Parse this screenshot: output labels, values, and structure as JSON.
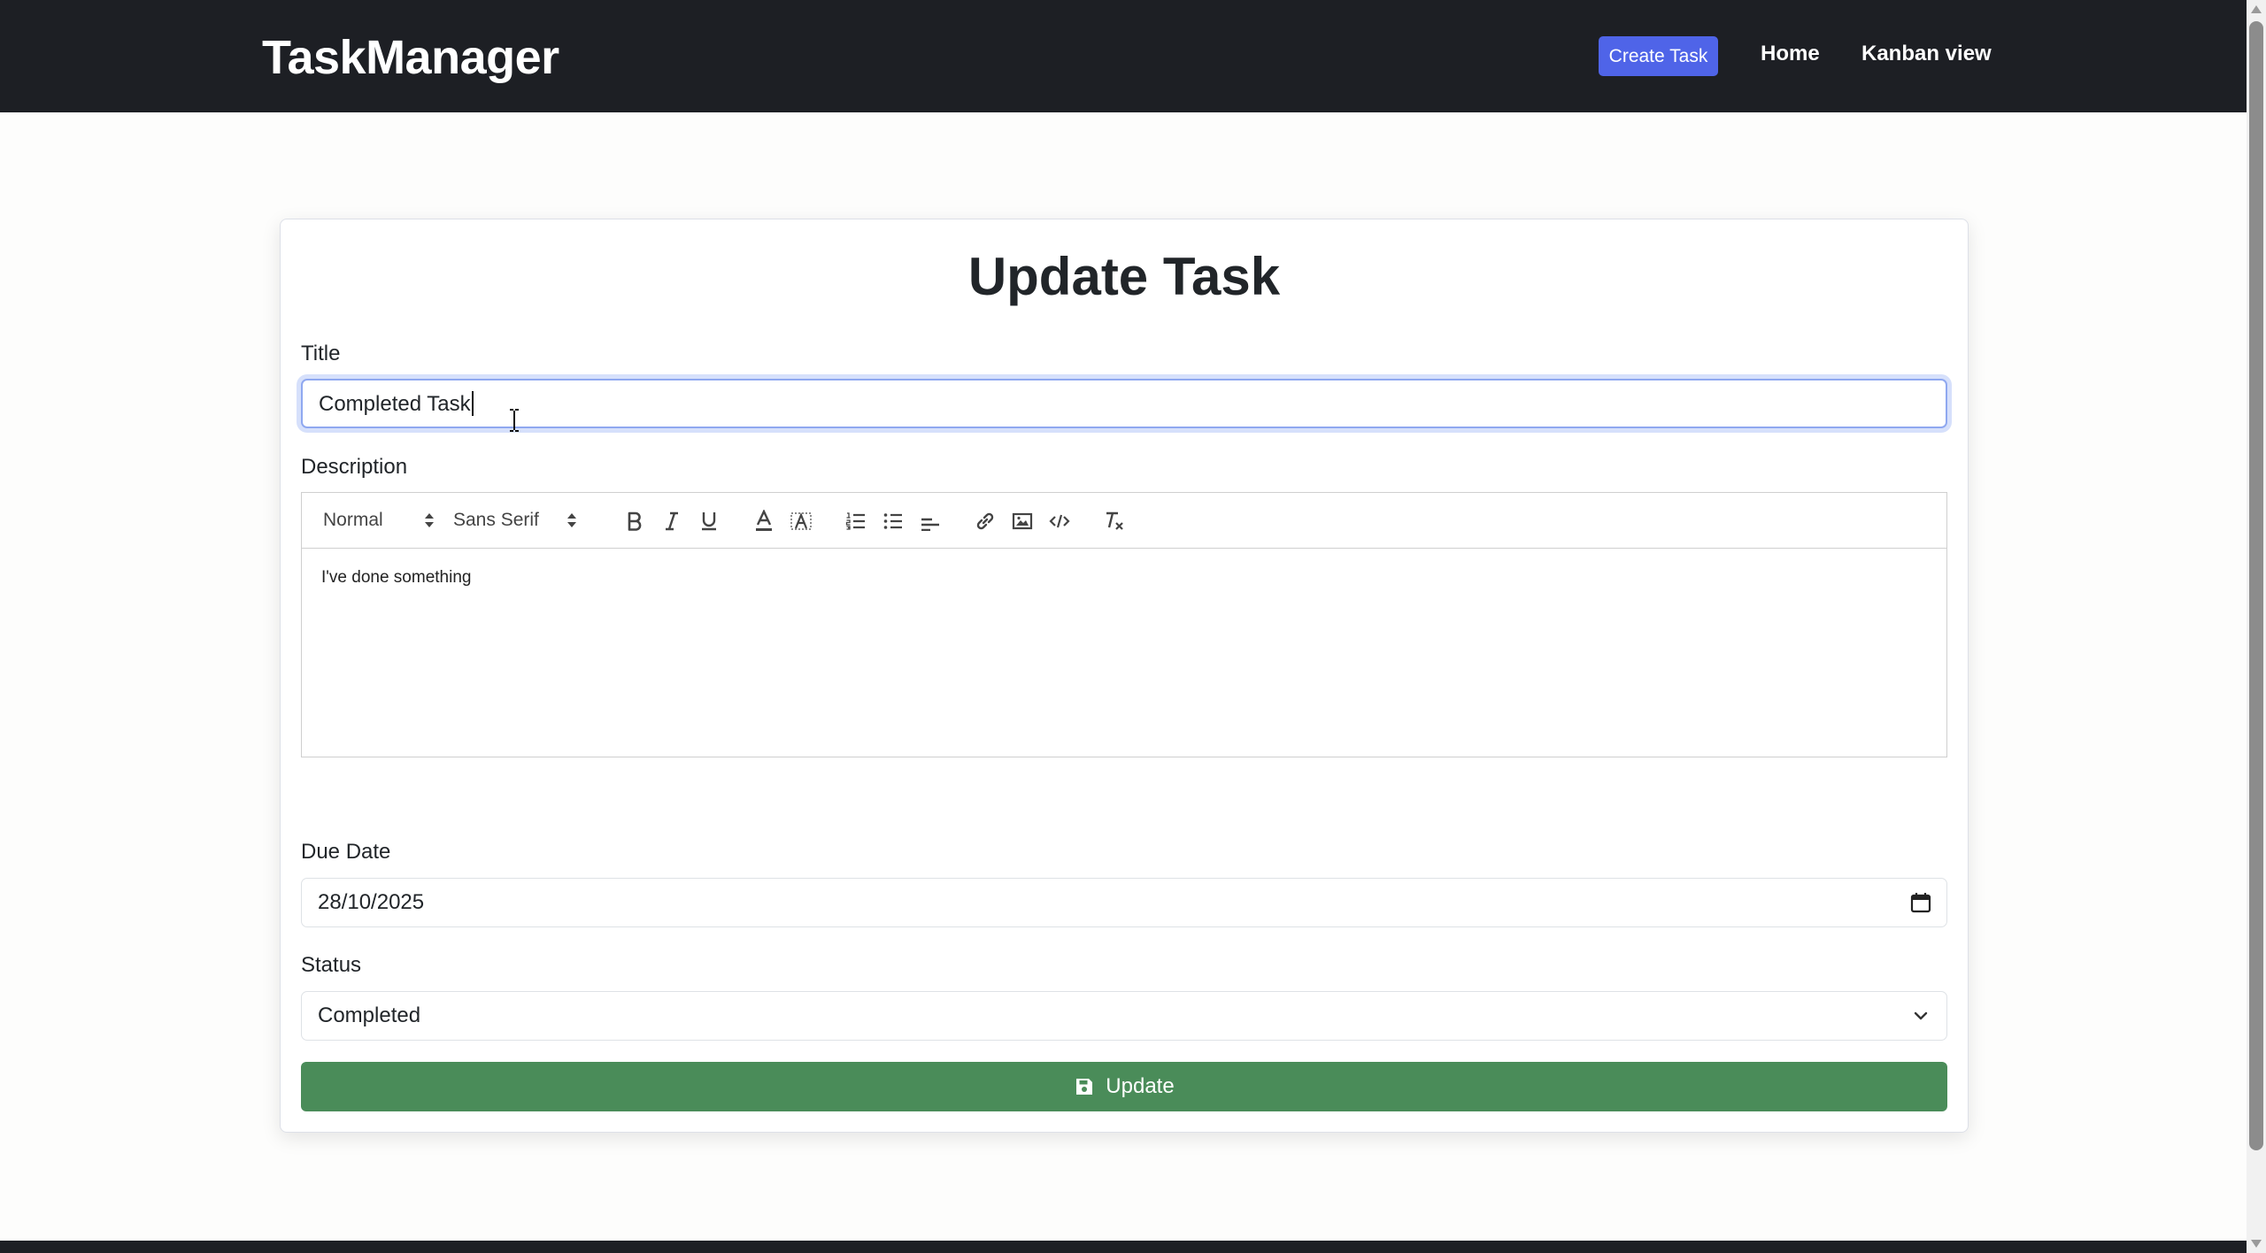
{
  "navbar": {
    "brand": "TaskManager",
    "create_label": "Create Task",
    "home_label": "Home",
    "kanban_label": "Kanban view"
  },
  "form": {
    "heading": "Update Task",
    "title_label": "Title",
    "title_value": "Completed Task",
    "description_label": "Description",
    "editor": {
      "header_picker": "Normal",
      "font_picker": "Sans Serif",
      "content": "I've done something"
    },
    "due_date_label": "Due Date",
    "due_date_value": "28/10/2025",
    "status_label": "Status",
    "status_value": "Completed",
    "submit_label": "Update"
  },
  "colors": {
    "navbar_bg": "#1d1f24",
    "create_button": "#4f64e8",
    "update_button": "#4a8c59"
  },
  "icons": {
    "toolbar": [
      "bold-icon",
      "italic-icon",
      "underline-icon",
      "text-color-icon",
      "background-color-icon",
      "ordered-list-icon",
      "bullet-list-icon",
      "align-icon",
      "link-icon",
      "image-icon",
      "code-icon",
      "clear-format-icon"
    ],
    "date": "calendar-icon",
    "select": "chevron-down-icon",
    "submit": "save-icon"
  }
}
